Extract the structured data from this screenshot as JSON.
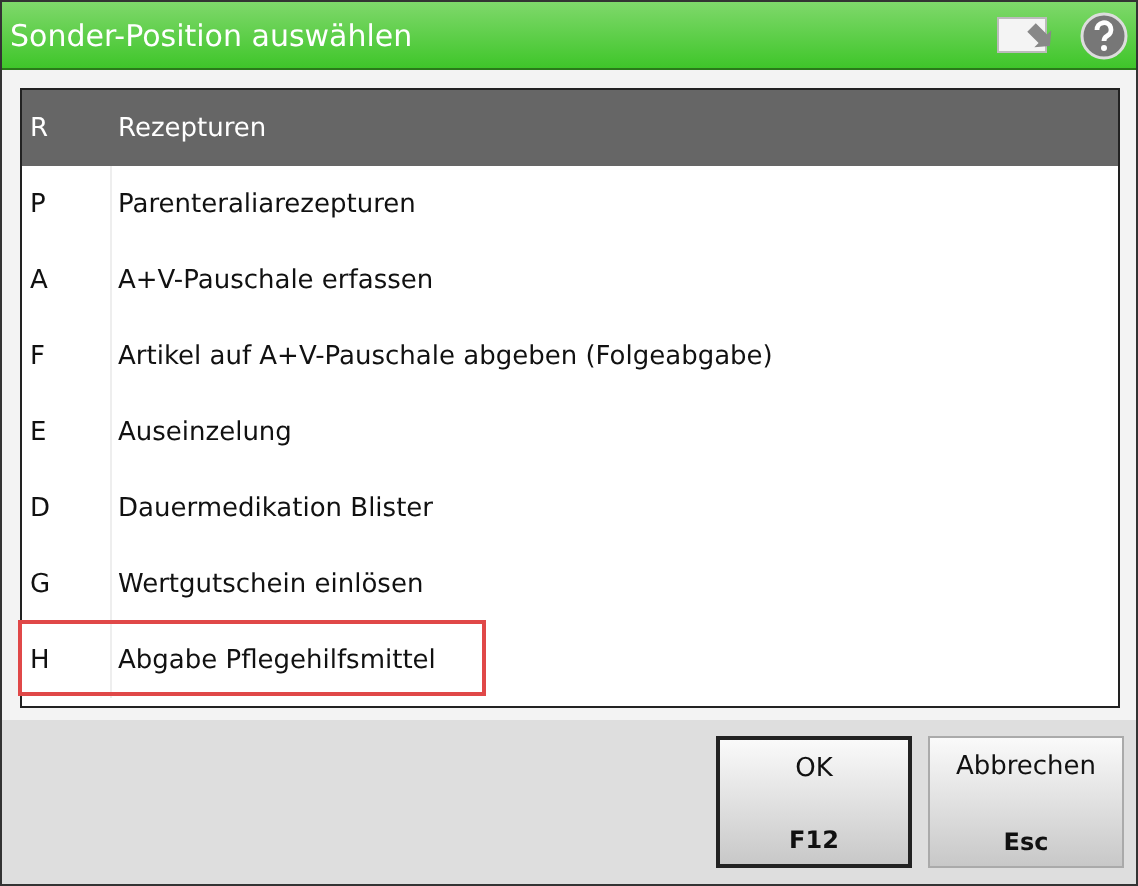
{
  "window": {
    "title": "Sonder-Position auswählen"
  },
  "rows": [
    {
      "key": "R",
      "label": "Rezepturen",
      "selected": true,
      "highlighted": false
    },
    {
      "key": "P",
      "label": "Parenteraliarezepturen",
      "selected": false,
      "highlighted": false
    },
    {
      "key": "A",
      "label": "A+V-Pauschale erfassen",
      "selected": false,
      "highlighted": false
    },
    {
      "key": "F",
      "label": "Artikel auf A+V-Pauschale abgeben (Folgeabgabe)",
      "selected": false,
      "highlighted": false
    },
    {
      "key": "E",
      "label": "Auseinzelung",
      "selected": false,
      "highlighted": false
    },
    {
      "key": "D",
      "label": "Dauermedikation Blister",
      "selected": false,
      "highlighted": false
    },
    {
      "key": "G",
      "label": "Wertgutschein einlösen",
      "selected": false,
      "highlighted": false
    },
    {
      "key": "H",
      "label": "Abgabe Pflegehilfsmittel",
      "selected": false,
      "highlighted": true
    }
  ],
  "buttons": [
    {
      "label": "OK",
      "shortcut": "F12",
      "default": true
    },
    {
      "label": "Abbrechen",
      "shortcut": "Esc",
      "default": false
    }
  ]
}
